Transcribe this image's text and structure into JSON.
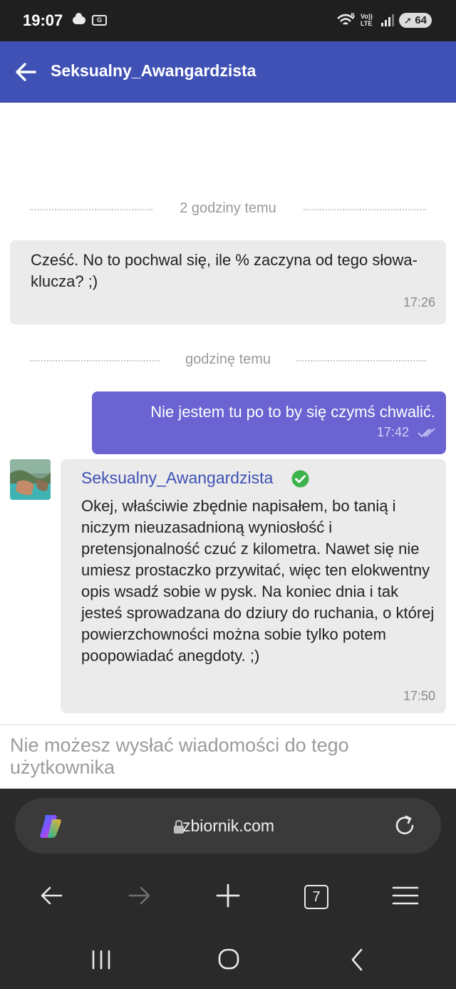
{
  "status_bar": {
    "time": "19:07",
    "battery": "64",
    "network": "LTE",
    "network_top": "Vo))",
    "wifi_badge": "5",
    "notif_icon_text": "G"
  },
  "header": {
    "title": "Seksualny_Awangardzista"
  },
  "chat": {
    "divider1": "2 godziny temu",
    "divider2": "godzinę temu",
    "messages": [
      {
        "direction": "incoming",
        "text": "Cześć. No to pochwal się, ile % zaczyna od tego słowa-klucza? ;)",
        "time": "17:26"
      },
      {
        "direction": "outgoing",
        "text": "Nie jestem tu po to by się czymś chwalić.",
        "time": "17:42"
      },
      {
        "direction": "incoming",
        "sender": "Seksualny_Awangardzista",
        "text": "Okej, właściwie zbędnie napisałem, bo tanią i niczym nieuzasadnioną wyniosłość i pretensjonalność czuć z kilometra. Nawet się nie umiesz prostaczko przywitać, więc ten elokwentny opis wsadź sobie w pysk. Na koniec dnia i tak jesteś sprowadzana do dziury do ruchania, o której powierzchowności można sobie tylko potem poopowiadać anegdoty. ;)",
        "time": "17:50"
      }
    ]
  },
  "composer": {
    "disabled_note": "Nie możesz wysłać wiadomości do tego użytkownika"
  },
  "browser": {
    "url": "zbiornik.com",
    "tab_count": "7"
  },
  "colors": {
    "header_bg": "#3f51b5",
    "outgoing_bubble": "#6a63d1",
    "incoming_bubble": "#ebebeb",
    "verified": "#3cb34a",
    "sender_name": "#3f51b5"
  },
  "icons": [
    "back-arrow-icon",
    "verified-icon",
    "read-receipt-icon",
    "lock-icon",
    "copilot-icon",
    "reload-icon",
    "tabs-icon",
    "menu-icon",
    "recents-icon",
    "home-icon"
  ]
}
